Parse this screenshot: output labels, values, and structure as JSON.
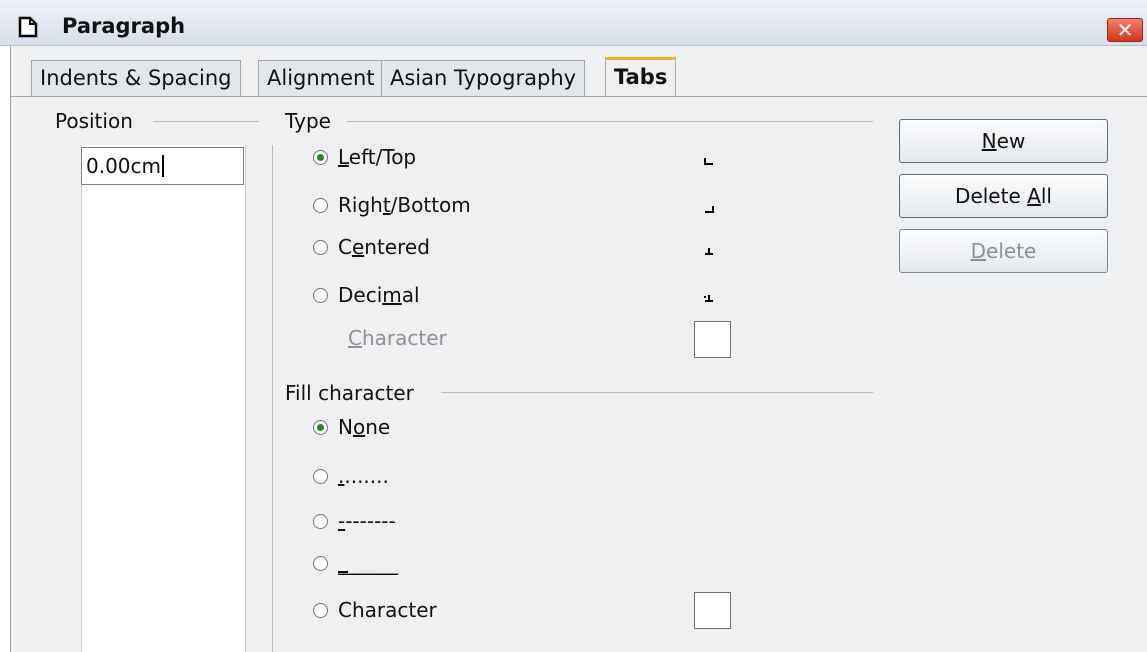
{
  "window": {
    "title": "Paragraph",
    "close_label": "✕"
  },
  "tabs": [
    {
      "label": "Indents & Spacing",
      "active": false
    },
    {
      "label": "Alignment",
      "active": false
    },
    {
      "label": "Asian Typography",
      "active": false
    },
    {
      "label": "Tabs",
      "active": true
    }
  ],
  "position": {
    "legend": "Position",
    "value": "0.00cm"
  },
  "type": {
    "legend": "Type",
    "options": [
      {
        "pre": "",
        "ul": "L",
        "post": "eft/Top",
        "checked": true
      },
      {
        "pre": "Righ",
        "ul": "t",
        "post": "/Bottom",
        "checked": false
      },
      {
        "pre": "C",
        "ul": "e",
        "post": "ntered",
        "checked": false
      },
      {
        "pre": "Deci",
        "ul": "m",
        "post": "al",
        "checked": false
      }
    ],
    "character": {
      "ul": "C",
      "post": "haracter"
    }
  },
  "fill": {
    "legend": "Fill character",
    "none": {
      "pre": "N",
      "ul": "o",
      "post": "ne",
      "checked": true
    },
    "dots": {
      "ul": ".",
      "post": "......."
    },
    "dashes": {
      "ul": "-",
      "post": "-------"
    },
    "underscore": {
      "ul": "_",
      "post": "_____"
    },
    "character": {
      "label": "Character"
    }
  },
  "buttons": {
    "new": {
      "ul": "N",
      "post": "ew"
    },
    "delete_all": {
      "pre": "Delete ",
      "ul": "A",
      "post": "ll"
    },
    "delete": {
      "ul": "D",
      "post": "elete"
    }
  },
  "colors": {
    "accent_tab": "#f5ae34",
    "radio_dot": "#2f7d32",
    "close": "#d2361c"
  }
}
